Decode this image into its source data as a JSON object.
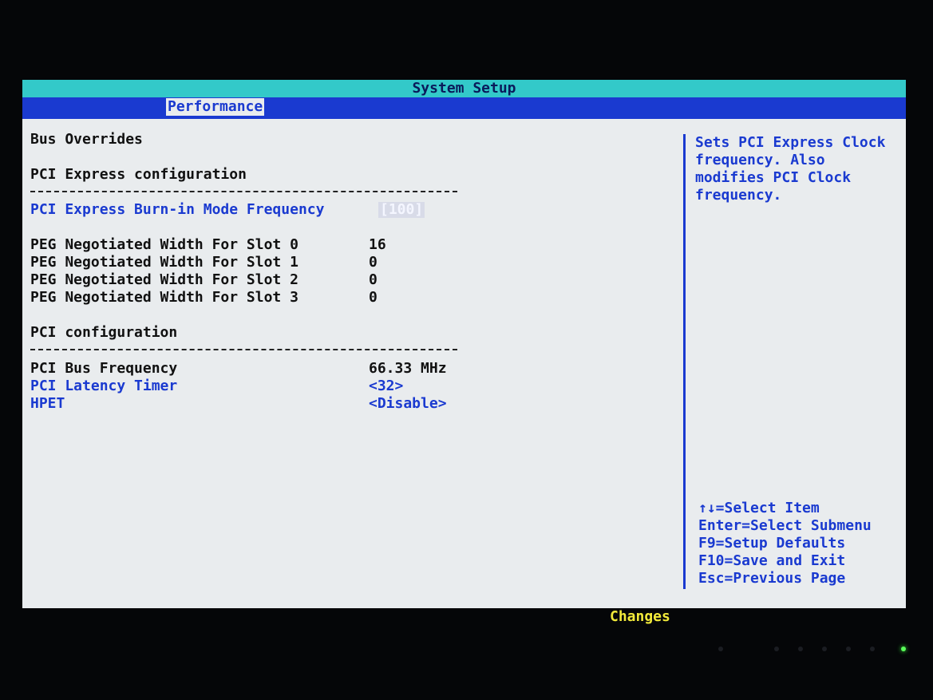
{
  "window": {
    "title": "System Setup"
  },
  "menu": {
    "active_tab": "Performance"
  },
  "main": {
    "section_title": "Bus Overrides",
    "pcie_header": "PCI Express configuration",
    "divider": "----------------------------------------",
    "burn_in": {
      "label": "PCI Express Burn-in Mode Frequency",
      "value": "[100]"
    },
    "peg_rows": [
      {
        "label": "PEG Negotiated Width For Slot 0",
        "value": "16"
      },
      {
        "label": "PEG Negotiated Width For Slot 1",
        "value": "0"
      },
      {
        "label": "PEG Negotiated Width For Slot 2",
        "value": "0"
      },
      {
        "label": "PEG Negotiated Width For Slot 3",
        "value": "0"
      }
    ],
    "pci_header": "PCI configuration",
    "pci_bus_freq": {
      "label": "PCI Bus Frequency",
      "value": "66.33 MHz"
    },
    "pci_latency": {
      "label": "PCI Latency Timer",
      "value": "<32>"
    },
    "hpet": {
      "label": "HPET",
      "value": "<Disable>"
    }
  },
  "help": {
    "lines": [
      "Sets PCI Express Clock",
      "frequency. Also",
      "modifies PCI Clock",
      "frequency."
    ],
    "keys": [
      "↑↓=Select Item",
      "Enter=Select Submenu",
      "F9=Setup Defaults",
      "F10=Save and Exit",
      "Esc=Previous Page"
    ]
  },
  "footer": {
    "changes_label": "Changes"
  },
  "colors": {
    "title_bg": "#33c9c9",
    "menu_bg": "#1a3ad0",
    "panel_bg": "#e9ecee",
    "accent": "#1a3ad0",
    "changes": "#f2ea3a"
  }
}
